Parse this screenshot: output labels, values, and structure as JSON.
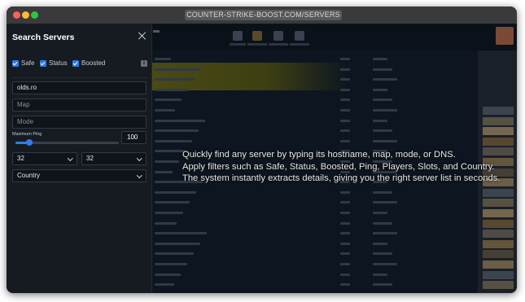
{
  "window": {
    "url": "COUNTER-STRIKE-BOOST.COM/SERVERS"
  },
  "panel": {
    "title": "Search Servers",
    "filters": [
      {
        "label": "Safe",
        "checked": true
      },
      {
        "label": "Status",
        "checked": true
      },
      {
        "label": "Boosted",
        "checked": true
      }
    ],
    "info_badge": "i",
    "hostname_value": "olds.ro",
    "map_placeholder": "Map",
    "mode_placeholder": "Mode",
    "ping_label": "Maximum Ping",
    "ping_value": "100",
    "ping_fraction": 0.13,
    "players_select": "32",
    "slots_select": "32",
    "country_select": "Country"
  },
  "overlay": {
    "lines": [
      "Quickly find any server by typing its hostname, map, mode, or DNS.",
      "Apply filters such as Safe, Status, Boosted, Ping, Players, Slots, and Country.",
      "The system instantly extracts details, giving you the right server list in seconds."
    ]
  },
  "colors": {
    "accent": "#2f7de8",
    "panel_bg": "#161b22",
    "window_bg": "#0b0f14",
    "highlight_row": "#4a4a13"
  }
}
